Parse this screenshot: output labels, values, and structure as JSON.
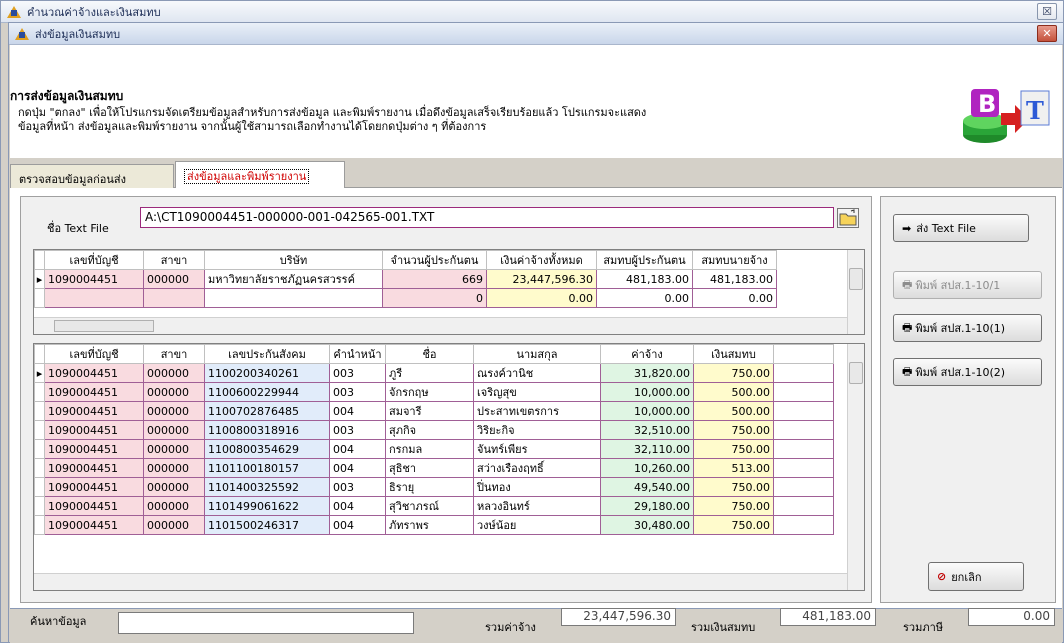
{
  "outer_window": {
    "title": "คำนวณค่าจ้างและเงินสมทบ",
    "close": "☒"
  },
  "inner_window": {
    "title": "ส่งข้อมูลเงินสมทบ",
    "close": "✕"
  },
  "header": {
    "title": "การส่งข้อมูลเงินสมทบ",
    "desc_line1": "กดปุ่ม \"ตกลง\" เพื่อให้โปรแกรมจัดเตรียมข้อมูลสำหรับการส่งข้อมูล และพิมพ์รายงาน เมื่อดึงข้อมูลเสร็จเรียบร้อยแล้ว โปรแกรมจะแสดง",
    "desc_line2": "ข้อมูลที่หน้า ส่งข้อมูลและพิมพ์รายงาน จากนั้นผู้ใช้สามารถเลือกทำงานได้โดยกดปุ่มต่าง ๆ ที่ต้องการ",
    "logo_b": "B",
    "logo_t": "T"
  },
  "tabs": [
    {
      "label": "ตรวจสอบข้อมูลก่อนส่ง"
    },
    {
      "label": "ส่งข้อมูลและพิมพ์รายงาน"
    }
  ],
  "file": {
    "label": "ชื่อ Text File",
    "value": "A:\\CT1090004451-000000-001-042565-001.TXT"
  },
  "top_grid": {
    "headers": [
      "เลขที่บัญชี",
      "สาขา",
      "บริษัท",
      "จำนวนผู้ประกันตน",
      "เงินค่าจ้างทั้งหมด",
      "สมทบผู้ประกันตน",
      "สมทบนายจ้าง"
    ],
    "rows": [
      [
        "1090004451",
        "000000",
        "มหาวิทยาลัยราชภัฏนครสวรรค์",
        "669",
        "23,447,596.30",
        "481,183.00",
        "481,183.00"
      ],
      [
        "",
        "",
        "",
        "0",
        "0.00",
        "0.00",
        "0.00"
      ]
    ]
  },
  "bottom_grid": {
    "headers": [
      "เลขที่บัญชี",
      "สาขา",
      "เลขประกันสังคม",
      "คำนำหน้า",
      "ชื่อ",
      "นามสกุล",
      "ค่าจ้าง",
      "เงินสมทบ"
    ],
    "rows": [
      [
        "1090004451",
        "000000",
        "1100200340261",
        "003",
        "ภูรี",
        "ณรงค์วานิช",
        "31,820.00",
        "750.00"
      ],
      [
        "1090004451",
        "000000",
        "1100600229944",
        "003",
        "จักรกฤษ",
        "เจริญสุข",
        "10,000.00",
        "500.00"
      ],
      [
        "1090004451",
        "000000",
        "1100702876485",
        "004",
        "สมจารี",
        "ประสาทเขตรการ",
        "10,000.00",
        "500.00"
      ],
      [
        "1090004451",
        "000000",
        "1100800318916",
        "003",
        "สุภกิจ",
        "วิริยะกิจ",
        "32,510.00",
        "750.00"
      ],
      [
        "1090004451",
        "000000",
        "1100800354629",
        "004",
        "กรกมล",
        "จันทร์เพียร",
        "32,110.00",
        "750.00"
      ],
      [
        "1090004451",
        "000000",
        "1101100180157",
        "004",
        "สุธิชา",
        "สว่างเรืองฤทธิ์",
        "10,260.00",
        "513.00"
      ],
      [
        "1090004451",
        "000000",
        "1101400325592",
        "003",
        "ธิรายุ",
        "ปิ่นทอง",
        "49,540.00",
        "750.00"
      ],
      [
        "1090004451",
        "000000",
        "1101499061622",
        "004",
        "สุวิชาภรณ์",
        "หลวงอินทร์",
        "29,180.00",
        "750.00"
      ],
      [
        "1090004451",
        "000000",
        "1101500246317",
        "004",
        "ภัทราพร",
        "วงษ์น้อย",
        "30,480.00",
        "750.00"
      ]
    ]
  },
  "buttons": {
    "send": "ส่ง Text File",
    "print1": "พิมพ์ สปส.1-10/1",
    "print2": "พิมพ์ สปส.1-10(1)",
    "print3": "พิมพ์ สปส.1-10(2)",
    "cancel": "ยกเลิก"
  },
  "footer": {
    "search_label": "ค้นหาข้อมูล",
    "wage_label": "รวมค่าจ้าง",
    "wage_value": "23,447,596.30",
    "contrib_label": "รวมเงินสมทบ",
    "contrib_value": "481,183.00",
    "tax_label": "รวมภาษี",
    "tax_value": "0.00"
  },
  "colors": {
    "accent": "#9b2a7c",
    "pink": "#f9dbe0",
    "yellow": "#fffbcc",
    "blue": "#e1ecfa",
    "green": "#dff5e3"
  }
}
